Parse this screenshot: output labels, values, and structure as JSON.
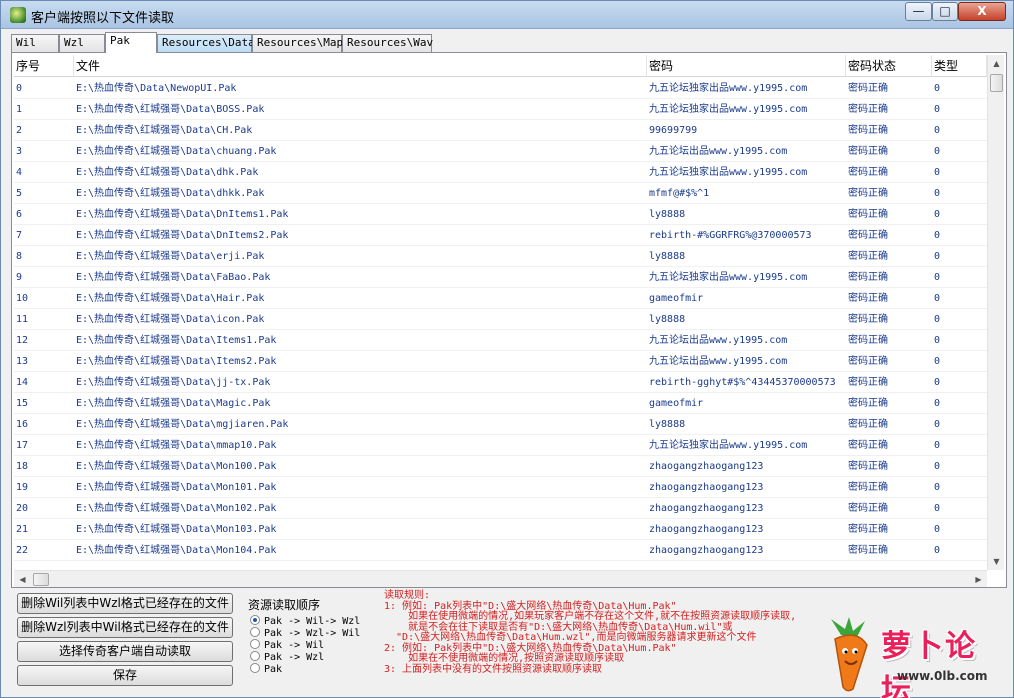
{
  "window": {
    "title": "客户端按照以下文件读取",
    "minimize": "—",
    "maximize": "□",
    "close": "X"
  },
  "tabs": [
    {
      "label": "Wil"
    },
    {
      "label": "Wzl"
    },
    {
      "label": "Pak"
    },
    {
      "label": "Resources\\Data"
    },
    {
      "label": "Resources\\Map"
    },
    {
      "label": "Resources\\Wav"
    }
  ],
  "table": {
    "columns": [
      "序号",
      "文件",
      "密码",
      "密码状态",
      "类型"
    ],
    "rows": [
      {
        "idx": "0",
        "file": "E:\\热血传奇\\Data\\NewopUI.Pak",
        "pwd": "九五论坛独家出品www.y1995.com",
        "status": "密码正确",
        "type": "0"
      },
      {
        "idx": "1",
        "file": "E:\\热血传奇\\红城强哥\\Data\\BOSS.Pak",
        "pwd": "九五论坛独家出品www.y1995.com",
        "status": "密码正确",
        "type": "0"
      },
      {
        "idx": "2",
        "file": "E:\\热血传奇\\红城强哥\\Data\\CH.Pak",
        "pwd": "99699799",
        "status": "密码正确",
        "type": "0"
      },
      {
        "idx": "3",
        "file": "E:\\热血传奇\\红城强哥\\Data\\chuang.Pak",
        "pwd": "九五论坛出品www.y1995.com",
        "status": "密码正确",
        "type": "0"
      },
      {
        "idx": "4",
        "file": "E:\\热血传奇\\红城强哥\\Data\\dhk.Pak",
        "pwd": "九五论坛独家出品www.y1995.com",
        "status": "密码正确",
        "type": "0"
      },
      {
        "idx": "5",
        "file": "E:\\热血传奇\\红城强哥\\Data\\dhkk.Pak",
        "pwd": "mfmf@#$%^1",
        "status": "密码正确",
        "type": "0"
      },
      {
        "idx": "6",
        "file": "E:\\热血传奇\\红城强哥\\Data\\DnItems1.Pak",
        "pwd": "ly8888",
        "status": "密码正确",
        "type": "0"
      },
      {
        "idx": "7",
        "file": "E:\\热血传奇\\红城强哥\\Data\\DnItems2.Pak",
        "pwd": "rebirth-#%GGRFRG%@370000573",
        "status": "密码正确",
        "type": "0"
      },
      {
        "idx": "8",
        "file": "E:\\热血传奇\\红城强哥\\Data\\erji.Pak",
        "pwd": "ly8888",
        "status": "密码正确",
        "type": "0"
      },
      {
        "idx": "9",
        "file": "E:\\热血传奇\\红城强哥\\Data\\FaBao.Pak",
        "pwd": "九五论坛独家出品www.y1995.com",
        "status": "密码正确",
        "type": "0"
      },
      {
        "idx": "10",
        "file": "E:\\热血传奇\\红城强哥\\Data\\Hair.Pak",
        "pwd": "gameofmir",
        "status": "密码正确",
        "type": "0"
      },
      {
        "idx": "11",
        "file": "E:\\热血传奇\\红城强哥\\Data\\icon.Pak",
        "pwd": "ly8888",
        "status": "密码正确",
        "type": "0"
      },
      {
        "idx": "12",
        "file": "E:\\热血传奇\\红城强哥\\Data\\Items1.Pak",
        "pwd": "九五论坛出品www.y1995.com",
        "status": "密码正确",
        "type": "0"
      },
      {
        "idx": "13",
        "file": "E:\\热血传奇\\红城强哥\\Data\\Items2.Pak",
        "pwd": "九五论坛出品www.y1995.com",
        "status": "密码正确",
        "type": "0"
      },
      {
        "idx": "14",
        "file": "E:\\热血传奇\\红城强哥\\Data\\jj-tx.Pak",
        "pwd": "rebirth-gghyt#$%^43445370000573",
        "status": "密码正确",
        "type": "0"
      },
      {
        "idx": "15",
        "file": "E:\\热血传奇\\红城强哥\\Data\\Magic.Pak",
        "pwd": "gameofmir",
        "status": "密码正确",
        "type": "0"
      },
      {
        "idx": "16",
        "file": "E:\\热血传奇\\红城强哥\\Data\\mgjiaren.Pak",
        "pwd": "ly8888",
        "status": "密码正确",
        "type": "0"
      },
      {
        "idx": "17",
        "file": "E:\\热血传奇\\红城强哥\\Data\\mmap10.Pak",
        "pwd": "九五论坛独家出品www.y1995.com",
        "status": "密码正确",
        "type": "0"
      },
      {
        "idx": "18",
        "file": "E:\\热血传奇\\红城强哥\\Data\\Mon100.Pak",
        "pwd": "zhaogangzhaogang123",
        "status": "密码正确",
        "type": "0"
      },
      {
        "idx": "19",
        "file": "E:\\热血传奇\\红城强哥\\Data\\Mon101.Pak",
        "pwd": "zhaogangzhaogang123",
        "status": "密码正确",
        "type": "0"
      },
      {
        "idx": "20",
        "file": "E:\\热血传奇\\红城强哥\\Data\\Mon102.Pak",
        "pwd": "zhaogangzhaogang123",
        "status": "密码正确",
        "type": "0"
      },
      {
        "idx": "21",
        "file": "E:\\热血传奇\\红城强哥\\Data\\Mon103.Pak",
        "pwd": "zhaogangzhaogang123",
        "status": "密码正确",
        "type": "0"
      },
      {
        "idx": "22",
        "file": "E:\\热血传奇\\红城强哥\\Data\\Mon104.Pak",
        "pwd": "zhaogangzhaogang123",
        "status": "密码正确",
        "type": "0"
      }
    ]
  },
  "buttons": {
    "delete_wil": "删除Wil列表中Wzl格式已经存在的文件",
    "delete_wzl": "删除Wzl列表中Wil格式已经存在的文件",
    "auto_read": "选择传奇客户端自动读取",
    "save": "保存"
  },
  "read_order": {
    "title": "资源读取顺序",
    "options": [
      "Pak -> Wil-> Wzl",
      "Pak -> Wzl-> Wil",
      "Pak -> Wil",
      "Pak -> Wzl",
      "Pak"
    ],
    "selected": 0
  },
  "rules": [
    "读取规则:",
    "1: 例如: Pak列表中\"D:\\盛大网络\\热血传奇\\Data\\Hum.Pak\"",
    "    如果在使用微端的情况,如果玩家客户端不存在这个文件,就不在按照资源读取顺序读取,",
    "    就是不会在往下读取是否有\"D:\\盛大网络\\热血传奇\\Data\\Hum.wil\"或",
    "  \"D:\\盛大网络\\热血传奇\\Data\\Hum.wzl\",而是向微端服务器请求更新这个文件",
    "2: 例如: Pak列表中\"D:\\盛大网络\\热血传奇\\Data\\Hum.Pak\"",
    "    如果在不使用微端的情况,按照资源读取顺序读取",
    "3: 上面列表中没有的文件按照资源读取顺序读取"
  ],
  "watermark": {
    "text": "萝卜论坛",
    "url": "www.0lb.com"
  },
  "colors": {
    "accent": "#1a3a8c",
    "rules": "#d42020",
    "logo": "#e9205a"
  }
}
